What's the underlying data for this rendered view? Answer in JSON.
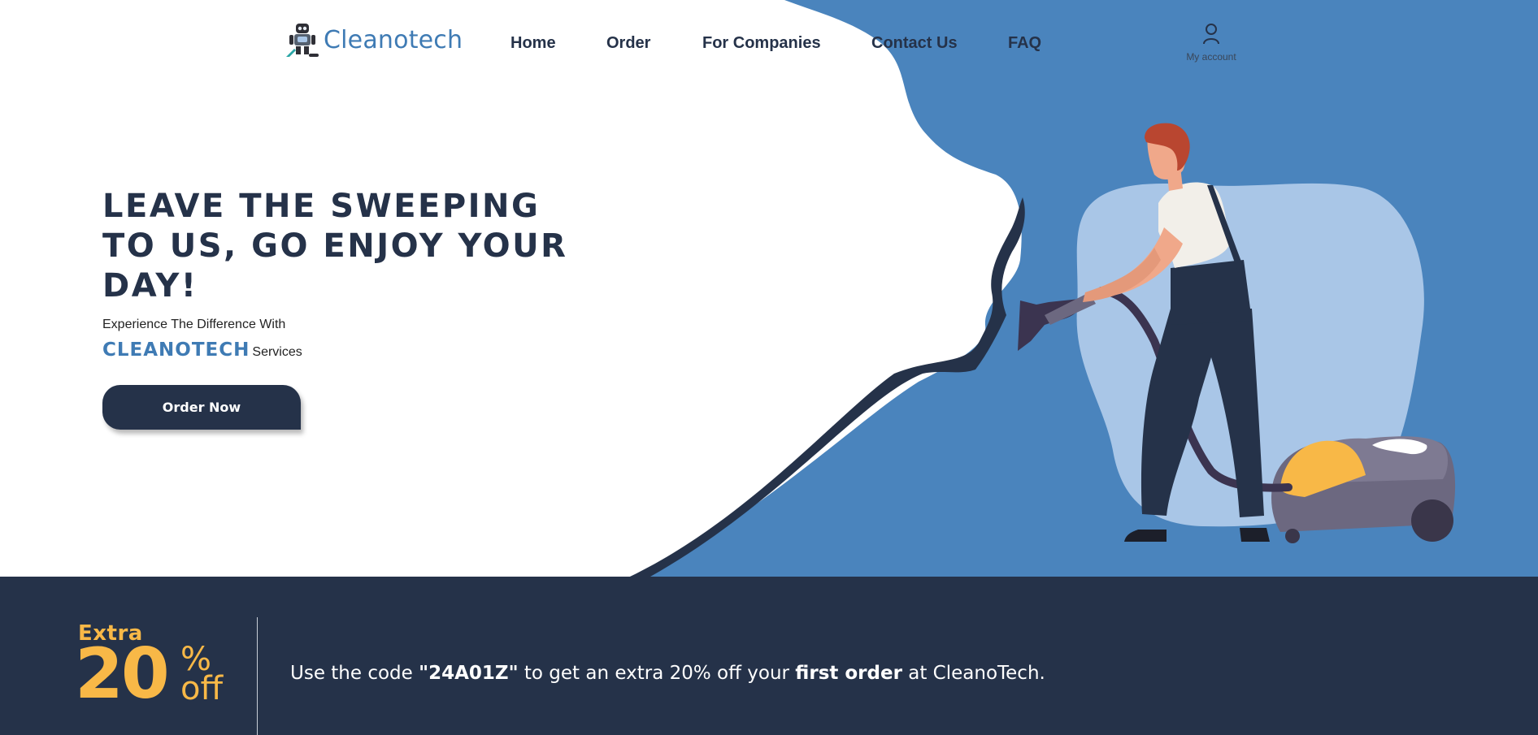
{
  "brand": {
    "name": "Cleanotech"
  },
  "nav": {
    "items": [
      {
        "label": "Home"
      },
      {
        "label": "Order"
      },
      {
        "label": "For Companies"
      },
      {
        "label": "Contact Us"
      },
      {
        "label": "FAQ"
      }
    ],
    "account_label": "My account"
  },
  "hero": {
    "headline": "LEAVE THE SWEEPING TO US, GO ENJOY YOUR DAY!",
    "subtitle": "Experience The Difference With",
    "brand_caps": "CLEANOTECH",
    "services": "Services",
    "cta_label": "Order Now"
  },
  "promo": {
    "extra": "Extra",
    "number": "20",
    "percent_sign": "%",
    "off": "off",
    "text_1": "Use the code ",
    "code": "\"24A01Z\"",
    "text_2": " to get an extra 20% off your ",
    "emphasis": "first order",
    "text_3": " at CleanoTech."
  },
  "colors": {
    "navy": "#253249",
    "blue": "#4a84bd",
    "light_blue": "#a9c6e7",
    "accent": "#f8b847",
    "brand_blue": "#3f7bb4"
  }
}
